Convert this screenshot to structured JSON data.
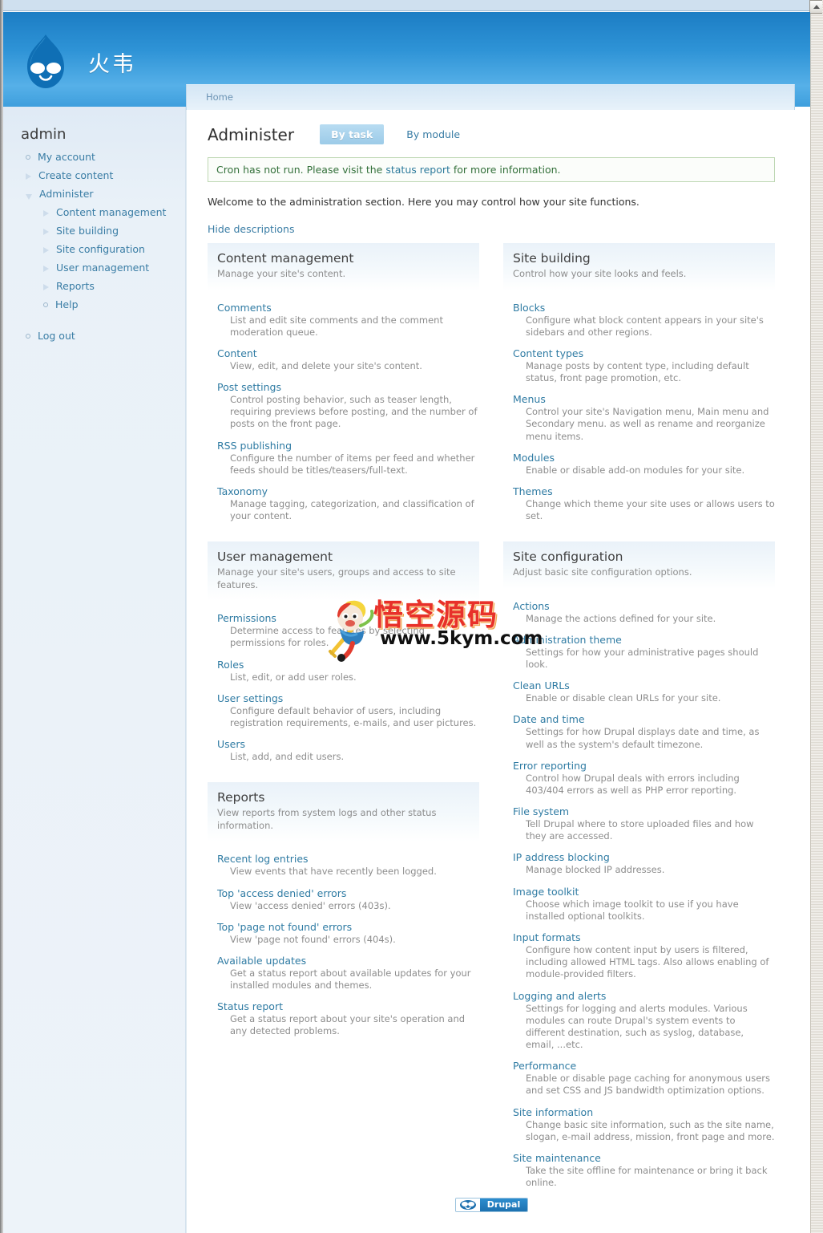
{
  "browser": {
    "scroll_up_icon": "triangle-up-icon"
  },
  "masthead": {
    "site_name": "火韦",
    "logo_icon": "drupal-drop-logo"
  },
  "breadcrumb": {
    "home": "Home"
  },
  "sidebar": {
    "title": "admin",
    "items": [
      {
        "label": "My account",
        "level": 1,
        "marker": "circle"
      },
      {
        "label": "Create content",
        "level": 1,
        "marker": "triangle-right"
      },
      {
        "label": "Administer",
        "level": 1,
        "marker": "triangle-down"
      },
      {
        "label": "Content management",
        "level": 2,
        "marker": "triangle-right"
      },
      {
        "label": "Site building",
        "level": 2,
        "marker": "triangle-right"
      },
      {
        "label": "Site configuration",
        "level": 2,
        "marker": "triangle-right"
      },
      {
        "label": "User management",
        "level": 2,
        "marker": "triangle-right"
      },
      {
        "label": "Reports",
        "level": 2,
        "marker": "triangle-right"
      },
      {
        "label": "Help",
        "level": 2,
        "marker": "circle"
      },
      {
        "label": "Log out",
        "level": 1,
        "marker": "circle"
      }
    ]
  },
  "page": {
    "title": "Administer",
    "tabs": [
      {
        "label": "By task",
        "active": true
      },
      {
        "label": "By module",
        "active": false
      }
    ],
    "status_message": {
      "before": "Cron has not run. Please visit the ",
      "link": "status report",
      "after": " for more information."
    },
    "welcome": "Welcome to the administration section. Here you may control how your site functions.",
    "hide_descriptions": "Hide descriptions"
  },
  "blocks": {
    "content_management": {
      "title": "Content management",
      "subtitle": "Manage your site's content.",
      "items": [
        {
          "label": "Comments",
          "desc": "List and edit site comments and the comment moderation queue."
        },
        {
          "label": "Content",
          "desc": "View, edit, and delete your site's content."
        },
        {
          "label": "Post settings",
          "desc": "Control posting behavior, such as teaser length, requiring previews before posting, and the number of posts on the front page."
        },
        {
          "label": "RSS publishing",
          "desc": "Configure the number of items per feed and whether feeds should be titles/teasers/full-text."
        },
        {
          "label": "Taxonomy",
          "desc": "Manage tagging, categorization, and classification of your content."
        }
      ]
    },
    "user_management": {
      "title": "User management",
      "subtitle": "Manage your site's users, groups and access to site features.",
      "items": [
        {
          "label": "Permissions",
          "desc": "Determine access to features by selecting permissions for roles."
        },
        {
          "label": "Roles",
          "desc": "List, edit, or add user roles."
        },
        {
          "label": "User settings",
          "desc": "Configure default behavior of users, including registration requirements, e-mails, and user pictures."
        },
        {
          "label": "Users",
          "desc": "List, add, and edit users."
        }
      ]
    },
    "reports": {
      "title": "Reports",
      "subtitle": "View reports from system logs and other status information.",
      "items": [
        {
          "label": "Recent log entries",
          "desc": "View events that have recently been logged."
        },
        {
          "label": "Top 'access denied' errors",
          "desc": "View 'access denied' errors (403s)."
        },
        {
          "label": "Top 'page not found' errors",
          "desc": "View 'page not found' errors (404s)."
        },
        {
          "label": "Available updates",
          "desc": "Get a status report about available updates for your installed modules and themes."
        },
        {
          "label": "Status report",
          "desc": "Get a status report about your site's operation and any detected problems."
        }
      ]
    },
    "site_building": {
      "title": "Site building",
      "subtitle": "Control how your site looks and feels.",
      "items": [
        {
          "label": "Blocks",
          "desc": "Configure what block content appears in your site's sidebars and other regions."
        },
        {
          "label": "Content types",
          "desc": "Manage posts by content type, including default status, front page promotion, etc."
        },
        {
          "label": "Menus",
          "desc": "Control your site's Navigation menu, Main menu and Secondary menu. as well as rename and reorganize menu items."
        },
        {
          "label": "Modules",
          "desc": "Enable or disable add-on modules for your site."
        },
        {
          "label": "Themes",
          "desc": "Change which theme your site uses or allows users to set."
        }
      ]
    },
    "site_configuration": {
      "title": "Site configuration",
      "subtitle": "Adjust basic site configuration options.",
      "items": [
        {
          "label": "Actions",
          "desc": "Manage the actions defined for your site."
        },
        {
          "label": "Administration theme",
          "desc": "Settings for how your administrative pages should look."
        },
        {
          "label": "Clean URLs",
          "desc": "Enable or disable clean URLs for your site."
        },
        {
          "label": "Date and time",
          "desc": "Settings for how Drupal displays date and time, as well as the system's default timezone."
        },
        {
          "label": "Error reporting",
          "desc": "Control how Drupal deals with errors including 403/404 errors as well as PHP error reporting."
        },
        {
          "label": "File system",
          "desc": "Tell Drupal where to store uploaded files and how they are accessed."
        },
        {
          "label": "IP address blocking",
          "desc": "Manage blocked IP addresses."
        },
        {
          "label": "Image toolkit",
          "desc": "Choose which image toolkit to use if you have installed optional toolkits."
        },
        {
          "label": "Input formats",
          "desc": "Configure how content input by users is filtered, including allowed HTML tags. Also allows enabling of module-provided filters."
        },
        {
          "label": "Logging and alerts",
          "desc": "Settings for logging and alerts modules. Various modules can route Drupal's system events to different destination, such as syslog, database, email, ...etc."
        },
        {
          "label": "Performance",
          "desc": "Enable or disable page caching for anonymous users and set CSS and JS bandwidth optimization options."
        },
        {
          "label": "Site information",
          "desc": "Change basic site information, such as the site name, slogan, e-mail address, mission, front page and more."
        },
        {
          "label": "Site maintenance",
          "desc": "Take the site offline for maintenance or bring it back online."
        }
      ]
    }
  },
  "footer": {
    "badge_label": "Drupal",
    "badge_icon": "drupal-drop-icon"
  },
  "watermark": {
    "chinese": "悟空源码",
    "url": "www.5kym.com",
    "mascot_icon": "monkey-king-mascot-icon"
  },
  "colors": {
    "masthead_blue": "#2e93d6",
    "link_blue": "#2f7ba3",
    "sidebar_bg": "#e9f1f8",
    "status_green": "#33703a",
    "watermark_red": "#e8312a"
  }
}
